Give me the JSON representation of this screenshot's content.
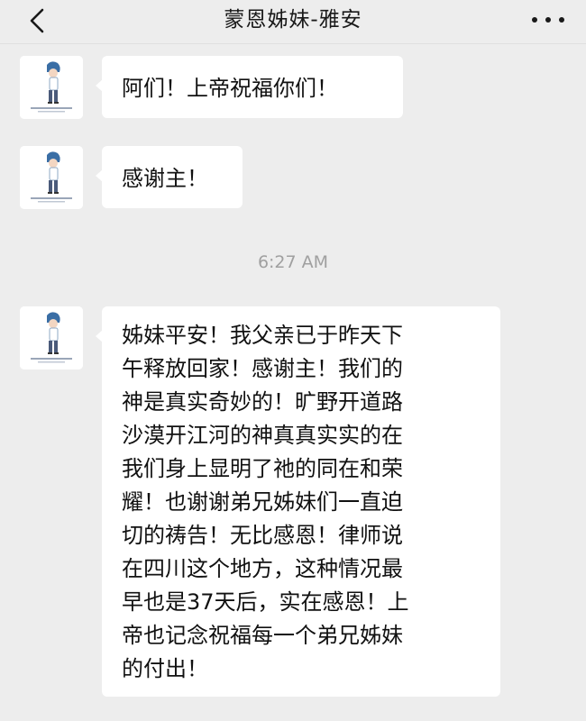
{
  "header": {
    "title": "蒙恩姊妹-雅安",
    "back_icon": "chevron-left-icon",
    "more_icon": "more-dots-icon"
  },
  "messages": [
    {
      "sender": "other",
      "text": "阿们！上帝祝福你们！"
    },
    {
      "sender": "other",
      "text": "感谢主！"
    },
    {
      "sender": "other",
      "text": "姊妹平安！我父亲已于昨天下\n午释放回家！感谢主！我们的\n神是真实奇妙的！旷野开道路\n沙漠开江河的神真真实实的在\n我们身上显明了祂的同在和荣\n耀！也谢谢弟兄姊妹们一直迫\n切的祷告！无比感恩！律师说\n在四川这个地方，这种情况最\n早也是37天后，实在感恩！上\n帝也记念祝福每一个弟兄姊妹\n的付出！"
    }
  ],
  "timestamp": "6:27 AM",
  "colors": {
    "background": "#ededed",
    "bubble": "#ffffff",
    "timestamp": "#a0a0a0"
  }
}
